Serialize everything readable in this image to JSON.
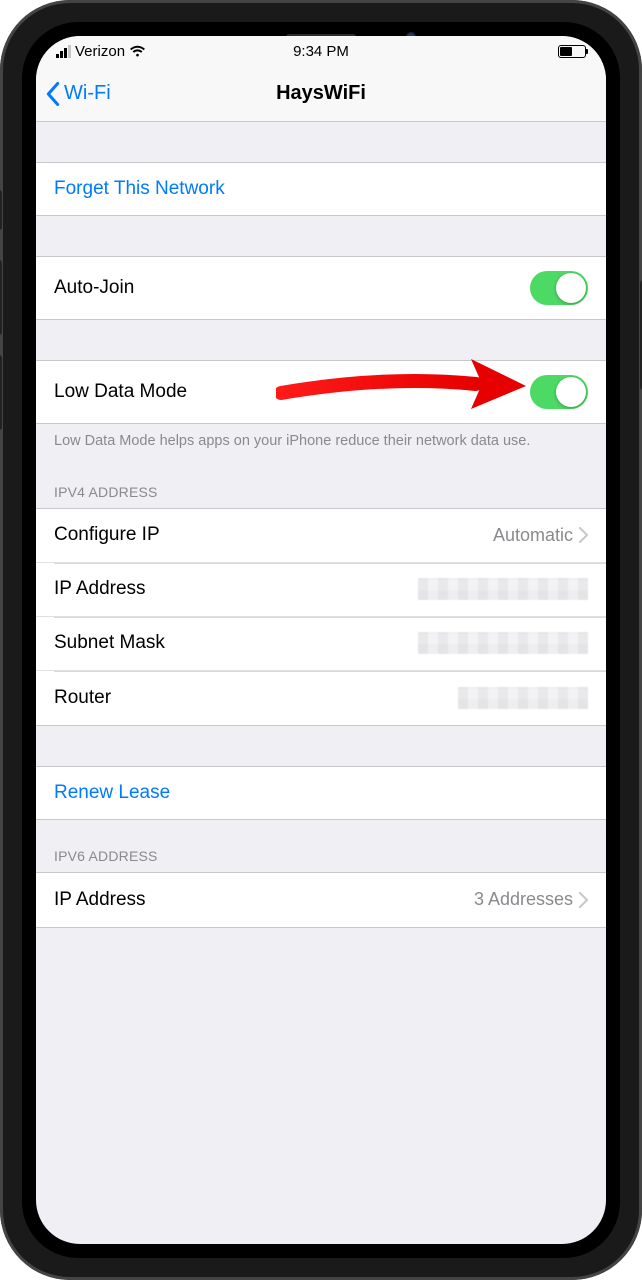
{
  "status_bar": {
    "carrier": "Verizon",
    "time": "9:34 PM"
  },
  "nav": {
    "back_label": "Wi-Fi",
    "title": "HaysWiFi"
  },
  "forget": {
    "label": "Forget This Network"
  },
  "auto_join": {
    "label": "Auto-Join",
    "on": true
  },
  "low_data": {
    "label": "Low Data Mode",
    "on": true,
    "footer": "Low Data Mode helps apps on your iPhone reduce their network data use."
  },
  "ipv4": {
    "header": "IPV4 ADDRESS",
    "configure_ip": {
      "label": "Configure IP",
      "value": "Automatic"
    },
    "ip_address": {
      "label": "IP Address"
    },
    "subnet_mask": {
      "label": "Subnet Mask"
    },
    "router": {
      "label": "Router"
    }
  },
  "renew": {
    "label": "Renew Lease"
  },
  "ipv6": {
    "header": "IPV6 ADDRESS",
    "ip_address": {
      "label": "IP Address",
      "value": "3 Addresses"
    }
  }
}
